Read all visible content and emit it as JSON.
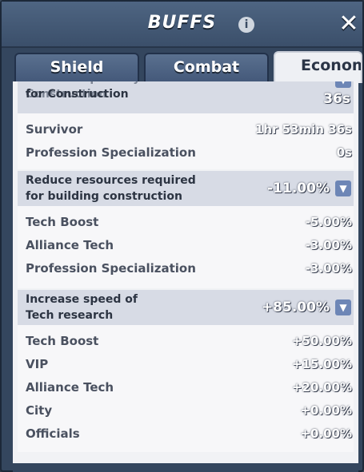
{
  "header": {
    "title": "BUFFS",
    "info_icon": "info-icon",
    "close_icon": "close-icon"
  },
  "tabs": [
    {
      "label": "Shield",
      "active": false
    },
    {
      "label": "Combat",
      "active": false
    },
    {
      "label": "Econom",
      "active": true
    }
  ],
  "sections": [
    {
      "title": "Increase speed by time for Construction",
      "title_visible": "for Construction",
      "value": "36s",
      "rows": [
        {
          "label": "Survivor",
          "value": "1hr 53min 36s"
        },
        {
          "label": "Profession Specialization",
          "value": "0s"
        }
      ]
    },
    {
      "title": "Reduce resources required for building construction",
      "value": "-11.00%",
      "rows": [
        {
          "label": "Tech Boost",
          "value": "-5.00%"
        },
        {
          "label": "Alliance Tech",
          "value": "-3.00%"
        },
        {
          "label": "Profession Specialization",
          "value": "-3.00%"
        }
      ]
    },
    {
      "title": "Increase speed of Tech research",
      "value": "+85.00%",
      "rows": [
        {
          "label": "Tech Boost",
          "value": "+50.00%"
        },
        {
          "label": "VIP",
          "value": "+15.00%"
        },
        {
          "label": "Alliance Tech",
          "value": "+20.00%"
        },
        {
          "label": "City",
          "value": "+0.00%"
        },
        {
          "label": "Officials",
          "value": "+0.00%"
        }
      ]
    }
  ],
  "colors": {
    "panel": "#34465e",
    "header": "#4e6582",
    "content": "#f1f2f5",
    "chevron": "#6d86b6"
  }
}
